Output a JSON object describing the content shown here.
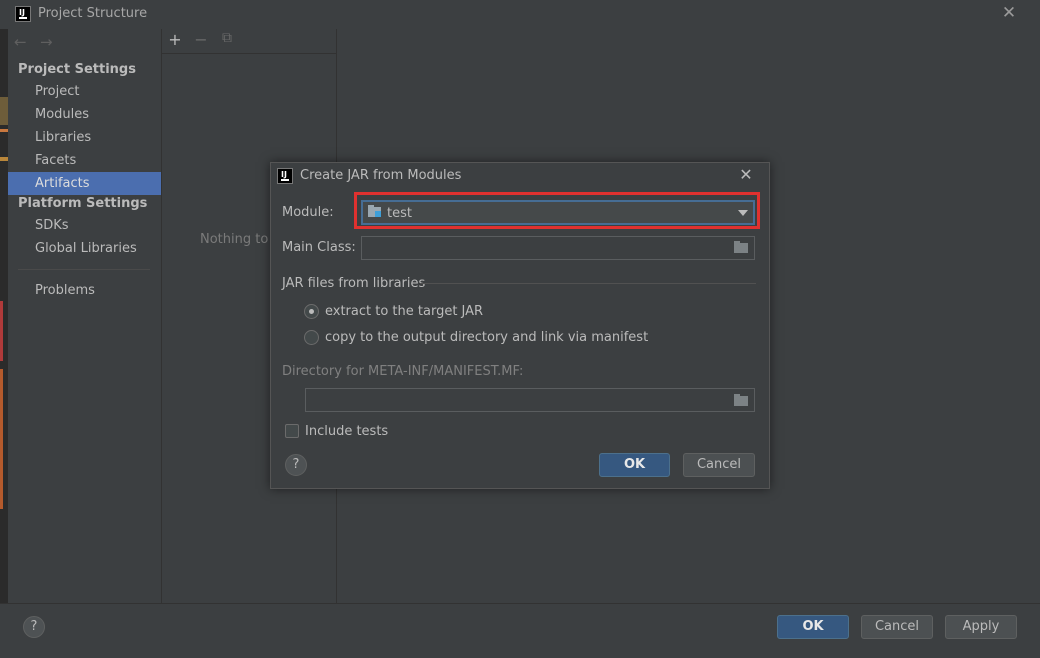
{
  "window": {
    "title": "Project Structure",
    "close_glyph": "✕"
  },
  "nav": {
    "back_glyph": "←",
    "forward_glyph": "→"
  },
  "sidebar": {
    "project_settings_header": "Project Settings",
    "platform_settings_header": "Platform Settings",
    "project_items": [
      "Project",
      "Modules",
      "Libraries",
      "Facets",
      "Artifacts"
    ],
    "platform_items": [
      "SDKs",
      "Global Libraries"
    ],
    "problems": "Problems",
    "selected": "Artifacts"
  },
  "middle": {
    "toolbar": {
      "add": "+",
      "remove": "−",
      "copy": "⧉"
    },
    "empty_text": "Nothing to s"
  },
  "footer": {
    "help": "?",
    "ok": "OK",
    "cancel": "Cancel",
    "apply": "Apply"
  },
  "dialog": {
    "title": "Create JAR from Modules",
    "close_glyph": "✕",
    "module_label": "Module:",
    "module_value": "test",
    "main_class_label": "Main Class:",
    "main_class_value": "",
    "jar_files_header": "JAR files from libraries",
    "radio_extract": "extract to the target JAR",
    "radio_copy": "copy to the output directory and link via manifest",
    "selected_option": "extract",
    "manifest_dir_label": "Directory for META-INF/MANIFEST.MF:",
    "manifest_dir_value": "",
    "include_tests_label": "Include tests",
    "include_tests_checked": false,
    "help": "?",
    "ok": "OK",
    "cancel": "Cancel"
  },
  "colors": {
    "background": "#3c3f41",
    "selection": "#4b6eaf",
    "primary_button": "#365880",
    "highlight_box": "#e0312f"
  },
  "icons": {
    "app": "intellij-icon",
    "folder": "folder-icon",
    "module": "module-folder-icon"
  }
}
